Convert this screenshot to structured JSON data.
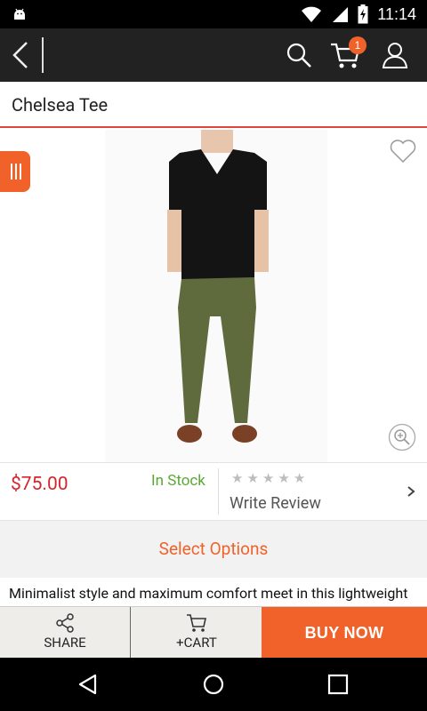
{
  "status_bar": {
    "time": "11:14",
    "icons": [
      "android-icon",
      "wifi-icon",
      "signal-icon",
      "battery-charging-icon"
    ]
  },
  "app_bar": {
    "cart_count": "1",
    "icons": [
      "back-icon",
      "search-icon",
      "cart-icon",
      "profile-icon"
    ]
  },
  "product": {
    "title": "Chelsea Tee",
    "price": "$75.00",
    "stock_status": "In Stock",
    "rating_stars": 0,
    "write_review": "Write Review",
    "select_options": "Select Options",
    "description": "Minimalist style and maximum comfort meet in this lightweight"
  },
  "actions": {
    "share_label": "SHARE",
    "cart_label": "+CART",
    "buy_now_label": "BUY NOW"
  },
  "colors": {
    "accent": "#f0622a",
    "price": "#d3262d",
    "in_stock": "#5aa833",
    "app_bar": "#222222"
  }
}
